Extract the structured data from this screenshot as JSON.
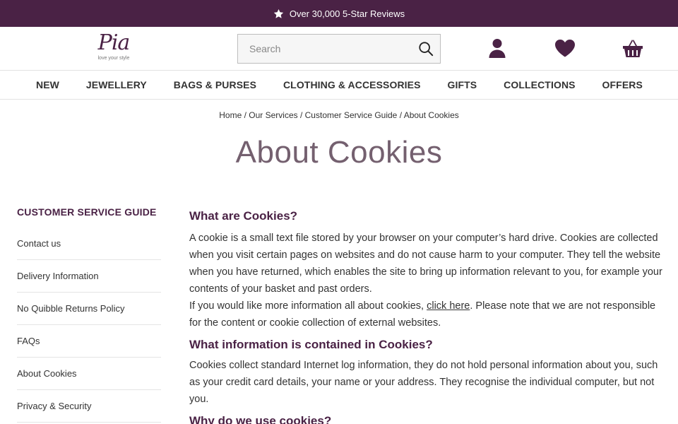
{
  "promo": {
    "text": "Over 30,000 5-Star Reviews",
    "icon": "star-icon"
  },
  "brand": {
    "logo_text": "Pia",
    "tagline": "love your style",
    "color": "#4a2245"
  },
  "search": {
    "placeholder": "Search",
    "value": ""
  },
  "header_icons": [
    "account-icon",
    "wishlist-heart-icon",
    "basket-icon"
  ],
  "nav": [
    "NEW",
    "JEWELLERY",
    "BAGS & PURSES",
    "CLOTHING & ACCESSORIES",
    "GIFTS",
    "COLLECTIONS",
    "OFFERS"
  ],
  "breadcrumb": [
    "Home",
    "Our Services",
    "Customer Service Guide",
    "About Cookies"
  ],
  "page_title": "About Cookies",
  "sidebar": {
    "heading": "CUSTOMER SERVICE GUIDE",
    "items": [
      "Contact us",
      "Delivery Information",
      "No Quibble Returns Policy",
      "FAQs",
      "About Cookies",
      "Privacy & Security"
    ]
  },
  "content": {
    "h1": "What are Cookies?",
    "p1": "A cookie is a small text file stored by your browser on your computer’s hard drive. Cookies are collected when you visit certain pages on websites and do not cause harm to your computer. They tell the website when you have returned, which enables the site to bring up information relevant to you, for example your contents of your basket and past orders.",
    "p2_before": "If you would like more information all about cookies, ",
    "p2_link": "click here",
    "p2_after": ". Please note that we are not responsible for the content or cookie collection of external websites.",
    "h2": "What information is contained in Cookies?",
    "p3": "Cookies collect standard Internet log information, they do not hold personal information about you, such as your credit card details, your name or your address. They recognise the individual computer, but not you.",
    "h3": "Why do we use cookies?"
  }
}
